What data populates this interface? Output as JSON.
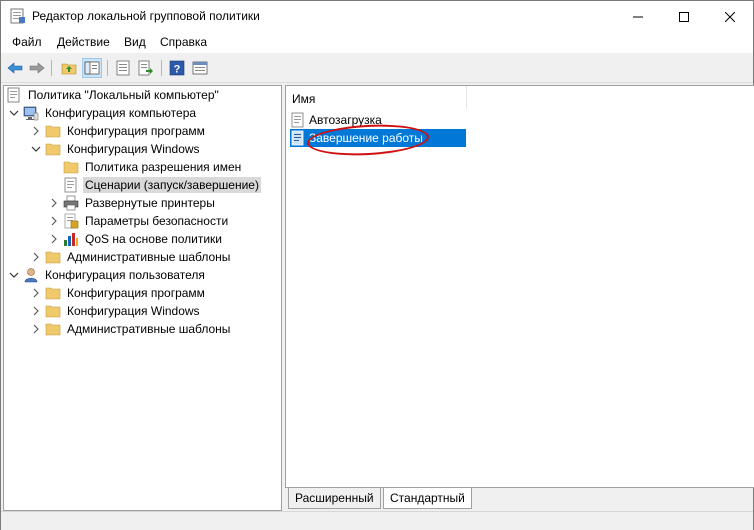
{
  "window": {
    "title": "Редактор локальной групповой политики"
  },
  "menu": [
    "Файл",
    "Действие",
    "Вид",
    "Справка"
  ],
  "toolbar": [
    "back-arrow-icon",
    "forward-arrow-icon",
    "up-folder-icon",
    "show-hide-tree-icon",
    "properties-icon",
    "export-list-icon",
    "help-icon",
    "view-pane-icon"
  ],
  "tree": {
    "root": "Политика \"Локальный компьютер\"",
    "computer": "Конфигурация компьютера",
    "c_programs": "Конфигурация программ",
    "c_windows": "Конфигурация Windows",
    "name_resolution": "Политика разрешения имен",
    "scripts": "Сценарии (запуск/завершение)",
    "printers": "Развернутые принтеры",
    "security": "Параметры безопасности",
    "qos": "QoS на основе политики",
    "c_admin": "Административные шаблоны",
    "user": "Конфигурация пользователя",
    "u_programs": "Конфигурация программ",
    "u_windows": "Конфигурация Windows",
    "u_admin": "Административные шаблоны"
  },
  "list": {
    "column_name": "Имя",
    "items": [
      "Автозагрузка",
      "Завершение работы"
    ]
  },
  "tabs": {
    "extended": "Расширенный",
    "standard": "Стандартный"
  },
  "colors": {
    "selection": "#0078d7",
    "highlight_ellipse": "#d01010",
    "folder": "#f0c96a"
  }
}
